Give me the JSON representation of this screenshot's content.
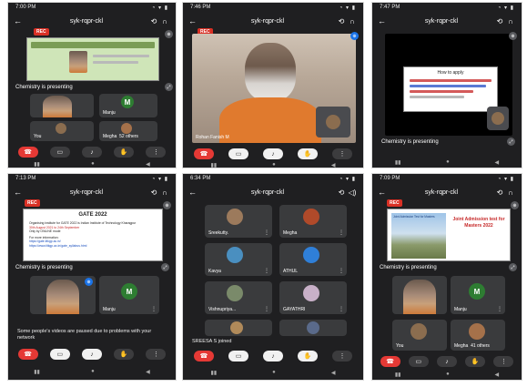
{
  "panels": [
    {
      "time": "7:00 PM",
      "code": "syk-rqpr-ckl",
      "rec": "REC",
      "presenting": "Chemistry is presenting",
      "tiles": [
        "Manju",
        "You",
        "Megha",
        "52 others"
      ],
      "avatar_letter": "M"
    },
    {
      "time": "7:46 PM",
      "code": "syk-rqpr-ckl",
      "rec": "REC",
      "speaker": "Rohan Fanish M"
    },
    {
      "time": "7:47 PM",
      "code": "syk-rqpr-ckl",
      "slide_title": "How to apply",
      "presenting": "Chemistry is presenting"
    },
    {
      "time": "7:13 PM",
      "code": "syk-rqpr-ckl",
      "rec": "REC",
      "slide_title": "GATE 2022",
      "slide_line1": "Organising institute for GATE 2022 is Indian Institute of Technology Kharagpur",
      "slide_line2": "30th August 2021 to 24th September",
      "slide_line3": "Only by ONLINE mode",
      "slide_more": "For more information:",
      "slide_link1": "https://gate.iitkgp.ac.in/",
      "slide_link2": "https://www.iitkgp.ac.in/gate_syllabus.html",
      "presenting": "Chemistry is presenting",
      "tile_name": "Manju",
      "avatar_letter": "M",
      "notice": "Some people's videos are paused due to problems with your network"
    },
    {
      "time": "6:34 PM",
      "code": "syk-rqpr-ckl",
      "names": [
        "Sreekutty.",
        "Megha",
        "Kavya",
        "ATHUL",
        "Vishnupriya...",
        "GAYATHRI"
      ],
      "joined": "SREESA S joined"
    },
    {
      "time": "7:09 PM",
      "code": "syk-rqpr-ckl",
      "rec": "REC",
      "slide_title": "Joint Admission test for Masters 2022",
      "slide_sub": "Joint Admission Test for Masters",
      "presenting": "Chemistry is presenting",
      "tiles": [
        "Manju",
        "You",
        "Megha",
        "41 others"
      ],
      "avatar_letter": "M"
    }
  ],
  "colors": {
    "end_call": "#e53935",
    "rec": "#d93025",
    "panel_bg": "#1f1f21",
    "avatar_green": "#2e7d32"
  },
  "icons": [
    "back-arrow-icon",
    "switch-camera-icon",
    "headphones-icon",
    "end-call-icon",
    "present-icon",
    "mic-off-icon",
    "raise-hand-icon",
    "more-icon",
    "pin-icon"
  ]
}
